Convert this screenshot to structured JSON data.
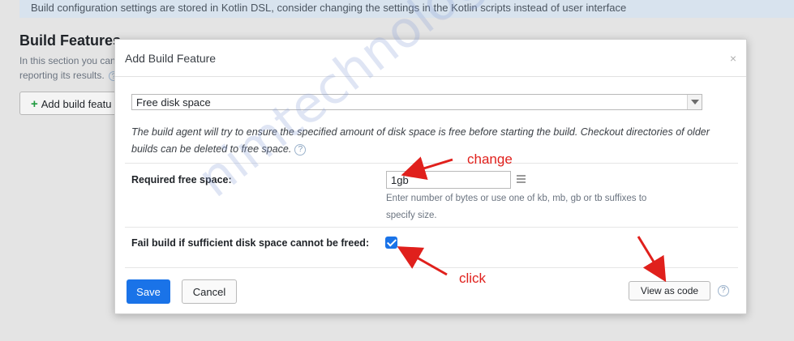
{
  "background": {
    "banner_text": "Build configuration settings are stored in Kotlin DSL, consider changing the settings in the Kotlin scripts instead of user interface",
    "section_title": "Build Features",
    "section_desc_line1": "In this section you can",
    "section_desc_line2": "reporting its results.",
    "help_glyph": "?",
    "add_button_plus": "+",
    "add_button_label": "Add build featu"
  },
  "dialog": {
    "title": "Add Build Feature",
    "close_glyph": "×",
    "feature_select": "Free disk space",
    "description": "The build agent will try to ensure the specified amount of disk space is free before starting the build. Checkout directories of older builds can be deleted to free space.",
    "help_glyph": "?",
    "required_space_label": "Required free space:",
    "required_space_value": "1gb",
    "required_space_hint": "Enter number of bytes or use one of kb, mb, gb or tb suffixes to specify size.",
    "fail_build_label": "Fail build if sufficient disk space cannot be freed:",
    "fail_build_checked": true,
    "save_label": "Save",
    "cancel_label": "Cancel",
    "view_code_label": "View as code"
  },
  "annotations": {
    "change_label": "change",
    "click_label": "click",
    "watermark": "nimtechnology.com",
    "color": "#e0201c"
  },
  "colors": {
    "accent": "#1a73e8",
    "banner_bg": "#d8e3ee"
  }
}
